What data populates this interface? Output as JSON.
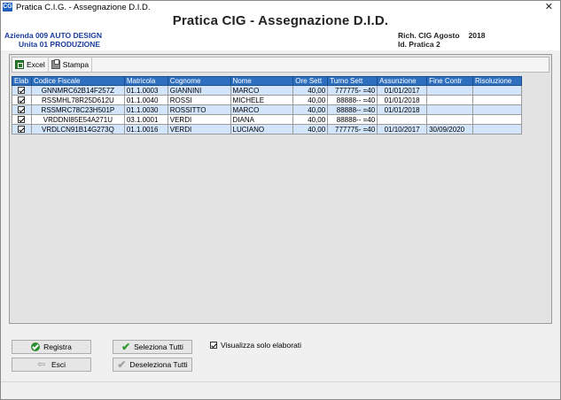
{
  "window": {
    "title": "Pratica C.I.G. - Assegnazione D.I.D.",
    "app_icon": "CG",
    "close_glyph": "✕"
  },
  "header": {
    "title": "Pratica CIG  -  Assegnazione D.I.D."
  },
  "info": {
    "azienda": "Azienda 009 AUTO DESIGN",
    "unita": "Unita 01 PRODUZIONE",
    "rich": "Rich.  CIG  Agosto",
    "year": "2018",
    "pratica": "Id. Pratica 2"
  },
  "toolbar": {
    "excel_label": "Excel",
    "stampa_label": "Stampa"
  },
  "table": {
    "columns": [
      "Elab",
      "Codice Fiscale",
      "Matricola",
      "Cognome",
      "Nome",
      "Ore Sett",
      "Turno Sett",
      "Assunzione",
      "Fine Contr",
      "Risoluzione"
    ],
    "rows": [
      {
        "elab": true,
        "cf": "GNNMRC62B14F257Z",
        "matricola": "01.1.0003",
        "cognome": "GIANNINI",
        "nome": "MARCO",
        "ore": "40,00",
        "turno": "777775- =40",
        "assunzione": "01/01/2017",
        "fine": "",
        "risoluzione": ""
      },
      {
        "elab": true,
        "cf": "RSSMHL78R25D612U",
        "matricola": "01.1.0040",
        "cognome": "ROSSI",
        "nome": "MICHELE",
        "ore": "40,00",
        "turno": "88888-- =40",
        "assunzione": "01/01/2018",
        "fine": "",
        "risoluzione": ""
      },
      {
        "elab": true,
        "cf": "RSSMRC78C23H501P",
        "matricola": "01.1.0030",
        "cognome": "ROSSITTO",
        "nome": "MARCO",
        "ore": "40,00",
        "turno": "88888-- =40",
        "assunzione": "01/01/2018",
        "fine": "",
        "risoluzione": ""
      },
      {
        "elab": true,
        "cf": "VRDDNI85E54A271U",
        "matricola": "03.1.0001",
        "cognome": "VERDI",
        "nome": "DIANA",
        "ore": "40,00",
        "turno": "88888-- =40",
        "assunzione": "",
        "fine": "",
        "risoluzione": ""
      },
      {
        "elab": true,
        "cf": "VRDLCN91B14G273Q",
        "matricola": "01.1.0016",
        "cognome": "VERDI",
        "nome": "LUCIANO",
        "ore": "40,00",
        "turno": "777775- =40",
        "assunzione": "01/10/2017",
        "fine": "30/09/2020",
        "risoluzione": ""
      }
    ]
  },
  "buttons": {
    "registra": "Registra",
    "esci": "Esci",
    "seleziona_tutti": "Seleziona Tutti",
    "deseleziona_tutti": "Deseleziona Tutti"
  },
  "visualizza": {
    "label": "Visualizza solo elaborati",
    "checked": true
  },
  "colors": {
    "header_blue": "#2e6fbf",
    "row_alt": "#d3e5fb",
    "info_blue": "#1a3c9b"
  }
}
